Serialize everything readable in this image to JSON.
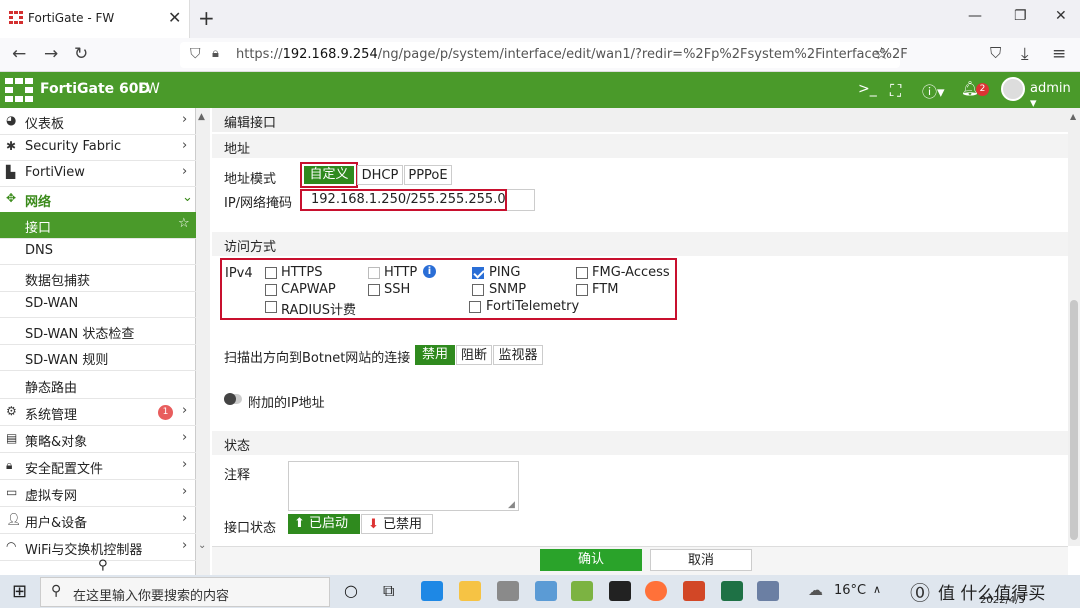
{
  "browser": {
    "tab_title": "FortiGate - FW",
    "url_prefix": "https://",
    "url_host": "192.168.9.254",
    "url_path": "/ng/page/p/system/interface/edit/wan1/?redir=%2Fp%2Fsystem%2Finterface%2F"
  },
  "header": {
    "product": "FortiGate 60D",
    "hostname": "FW",
    "notifications_count": "2",
    "user": "admin"
  },
  "sidebar": {
    "items": [
      {
        "label": "仪表板",
        "icon": "dashboard-icon"
      },
      {
        "label": "Security Fabric",
        "icon": "fabric-icon"
      },
      {
        "label": "FortiView",
        "icon": "chart-icon"
      },
      {
        "label": "网络",
        "icon": "network-icon"
      },
      {
        "label": "接口"
      },
      {
        "label": "DNS"
      },
      {
        "label": "数据包捕获"
      },
      {
        "label": "SD-WAN"
      },
      {
        "label": "SD-WAN 状态检查"
      },
      {
        "label": "SD-WAN 规则"
      },
      {
        "label": "静态路由"
      },
      {
        "label": "系统管理",
        "icon": "gear-icon",
        "badge": "1"
      },
      {
        "label": "策略&对象",
        "icon": "policy-icon"
      },
      {
        "label": "安全配置文件",
        "icon": "lock-icon"
      },
      {
        "label": "虚拟专网",
        "icon": "monitor-icon"
      },
      {
        "label": "用户&设备",
        "icon": "user-icon"
      },
      {
        "label": "WiFi与交换机控制器",
        "icon": "wifi-icon"
      }
    ]
  },
  "form": {
    "page_title": "编辑接口",
    "address_section": "地址",
    "address_mode_label": "地址模式",
    "address_modes": [
      "自定义",
      "DHCP",
      "PPPoE"
    ],
    "ip_mask_label": "IP/网络掩码",
    "ip_mask_value": "192.168.1.250/255.255.255.0",
    "access_section": "访问方式",
    "ipv4_label": "IPv4",
    "access_options": [
      {
        "label": "HTTPS",
        "checked": false
      },
      {
        "label": "HTTP",
        "checked": false
      },
      {
        "label": "PING",
        "checked": true
      },
      {
        "label": "FMG-Access",
        "checked": false
      },
      {
        "label": "CAPWAP",
        "checked": false
      },
      {
        "label": "SSH",
        "checked": false
      },
      {
        "label": "SNMP",
        "checked": false
      },
      {
        "label": "FTM",
        "checked": false
      },
      {
        "label": "RADIUS计费",
        "checked": false
      },
      {
        "label": "FortiTelemetry",
        "checked": false
      }
    ],
    "botnet_label": "扫描出方向到Botnet网站的连接",
    "botnet_options": [
      "禁用",
      "阻断",
      "监视器"
    ],
    "secondary_ip_label": "附加的IP地址",
    "status_section": "状态",
    "comment_label": "注释",
    "interface_status_label": "接口状态",
    "status_enabled": "已启动",
    "status_disabled": "已禁用"
  },
  "footer": {
    "ok": "确认",
    "cancel": "取消"
  },
  "taskbar": {
    "search_placeholder": "在这里输入你要搜索的内容",
    "temperature": "16°C",
    "date": "2022/4/5",
    "watermark": "值 什么值得买"
  }
}
